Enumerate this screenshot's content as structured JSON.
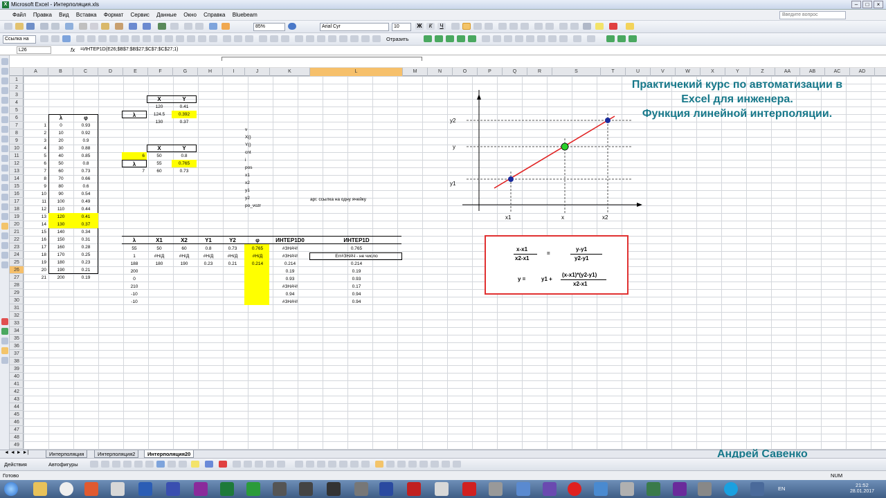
{
  "window": {
    "title": "Microsoft Excel - Интерполяция.xls",
    "icon_name": "excel-icon"
  },
  "menu": [
    "Файл",
    "Правка",
    "Вид",
    "Вставка",
    "Формат",
    "Сервис",
    "Данные",
    "Окно",
    "Справка",
    "Bluebeam"
  ],
  "help_placeholder": "Введите вопрос",
  "toolbar": {
    "zoom": "85%",
    "font": "Arial Cyr",
    "size": "10"
  },
  "toolbar2": {
    "link_label": "Ссылка на",
    "send_label": "Отразить"
  },
  "formula_bar": {
    "name_box": "L26",
    "fx": "fx",
    "formula": "=ИНТЕР1D(E26;$B$7:$B$27;$C$7:$C$27;1)"
  },
  "columns": [
    "A",
    "B",
    "C",
    "D",
    "E",
    "F",
    "G",
    "H",
    "I",
    "J",
    "K",
    "L",
    "M",
    "N",
    "O",
    "P",
    "Q",
    "R",
    "S",
    "T",
    "U",
    "V",
    "W",
    "X",
    "Y",
    "Z",
    "AA",
    "AB",
    "AC",
    "AD"
  ],
  "rows": [
    "1",
    "2",
    "3",
    "4",
    "5",
    "6",
    "7",
    "8",
    "9",
    "10",
    "11",
    "12",
    "13",
    "14",
    "15",
    "16",
    "17",
    "18",
    "19",
    "20",
    "21",
    "22",
    "23",
    "24",
    "25",
    "26",
    "27",
    "28",
    "29",
    "30",
    "31",
    "32",
    "33",
    "34",
    "35",
    "36",
    "37",
    "38",
    "39",
    "40",
    "41",
    "42",
    "43",
    "44",
    "45",
    "46",
    "47",
    "48",
    "49"
  ],
  "table_lambda": {
    "headers": [
      "λ",
      "φ"
    ],
    "index": [
      "1",
      "2",
      "3",
      "4",
      "5",
      "6",
      "7",
      "8",
      "9",
      "10",
      "11",
      "12",
      "13",
      "14",
      "15",
      "16",
      "17",
      "18",
      "19",
      "20",
      "21"
    ],
    "lambda": [
      "0",
      "10",
      "20",
      "30",
      "40",
      "50",
      "60",
      "70",
      "80",
      "90",
      "100",
      "110",
      "120",
      "130",
      "140",
      "150",
      "160",
      "170",
      "180",
      "190",
      "200"
    ],
    "phi": [
      "0.93",
      "0.92",
      "0.9",
      "0.88",
      "0.85",
      "0.8",
      "0.73",
      "0.66",
      "0.6",
      "0.54",
      "0.49",
      "0.44",
      "0.41",
      "0.37",
      "0.34",
      "0.31",
      "0.28",
      "0.25",
      "0.23",
      "0.21",
      "0.19"
    ]
  },
  "block1": {
    "hx": "X",
    "hy": "Y",
    "label": "λ",
    "x": [
      "120",
      "124.5",
      "130"
    ],
    "y": [
      "0.41",
      "0.392",
      "0.37"
    ]
  },
  "block2": {
    "hx": "X",
    "hy": "Y",
    "label": "λ",
    "x": [
      "50",
      "55",
      "60"
    ],
    "y": [
      "0.8",
      "0.765",
      "0.73"
    ],
    "left": [
      "6",
      "7"
    ]
  },
  "vars": [
    "v",
    "X()",
    "Y()",
    "cnt",
    "i",
    "pos",
    "x1",
    "x2",
    "y1",
    "y2",
    "po_vozr"
  ],
  "note": "арг. ссылка на одну ячейку",
  "bottom": {
    "headers": [
      "λ",
      "X1",
      "X2",
      "Y1",
      "Y2",
      "φ",
      "ИНТЕР1D0",
      "ИНТЕР1D"
    ],
    "rows": [
      [
        "55",
        "50",
        "60",
        "0.8",
        "0.73",
        "0.765",
        "#ЗНАЧ!",
        "0.765"
      ],
      [
        "1",
        "#Н/Д",
        "#Н/Д",
        "#Н/Д",
        "#Н/Д",
        "#Н/Д",
        "#ЗНАЧ!",
        "Err#ЗНАЧ - не число"
      ],
      [
        "188",
        "180",
        "190",
        "0.23",
        "0.21",
        "0.214",
        "0.214",
        "0.214"
      ],
      [
        "200",
        "",
        "",
        "",
        "",
        "",
        "0.19",
        "0.19"
      ],
      [
        "0",
        "",
        "",
        "",
        "",
        "",
        "0.93",
        "0.93"
      ],
      [
        "210",
        "",
        "",
        "",
        "",
        "",
        "#ЗНАЧ!",
        "0.17"
      ],
      [
        "-10",
        "",
        "",
        "",
        "",
        "",
        "0.94",
        "0.94"
      ],
      [
        "-10",
        "",
        "",
        "",
        "",
        "",
        "#ЗНАЧ!",
        "0.94"
      ]
    ]
  },
  "diagram": {
    "y_labels": [
      "y2",
      "y",
      "y1"
    ],
    "x_labels": [
      "x1",
      "x",
      "x2"
    ]
  },
  "annotation": [
    "Практичекий курс по автоматизации в",
    "Excel для инженера.",
    "Функция линейной  интерполяции."
  ],
  "formula_box": {
    "num1": "x-x1",
    "den1": "x2-x1",
    "eq": "=",
    "num2": "y-y1",
    "den2": "y2-y1",
    "y_eq": "y =",
    "y1_plus": "y1 +",
    "num3": "(x-x1)*(y2-y1)",
    "den3": "x2-x1"
  },
  "sheet_tabs": [
    "Интерполяция",
    "Интерполяция2",
    "Интерполяция20"
  ],
  "draw_bar": {
    "actions": "Действия",
    "autoshapes": "Автофигуры"
  },
  "status": {
    "ready": "Готово",
    "num": "NUM"
  },
  "tray": {
    "lang": "EN",
    "time": "21:52",
    "date": "28.01.2017"
  },
  "author": "Андрей Савенко",
  "colors": {
    "yellow": "#ffff00",
    "teal": "#17788a",
    "red": "#e03030",
    "green_point": "#2bd12b",
    "blue_point": "#1a2b9c"
  }
}
